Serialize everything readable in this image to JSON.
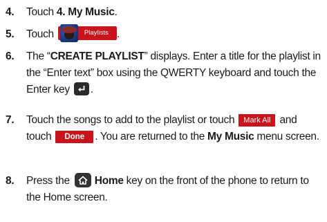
{
  "steps": [
    {
      "number": "4.",
      "pre": "Touch ",
      "bold": "4. My Music",
      "post": "."
    },
    {
      "number": "5.",
      "pre": "Touch ",
      "button_label": "Playlists",
      "post": "."
    },
    {
      "number": "6.",
      "pre": "The “",
      "bold": "CREATE PLAYLIST",
      "mid": "” displays. Enter a title for the playlist in the “Enter text” box using the QWERTY keyboard and touch the Enter key",
      "icon": "enter-key-icon",
      "post": "."
    },
    {
      "number": "7.",
      "pre": "Touch the songs to add to the playlist or touch",
      "mark_all_label": "Mark All",
      "mid": "and touch",
      "done_label": "Done",
      "post_a": ". You are returned to the ",
      "bold": "My Music",
      "post_b": " menu screen."
    },
    {
      "number": "8.",
      "pre": "Press the",
      "icon": "home-key-icon",
      "bold": "Home",
      "post": " key on the front of the phone to return to the Home screen."
    }
  ],
  "colors": {
    "accent_red": "#c8141a",
    "key_dark": "#2a2a2a",
    "text": "#1a1a1a"
  }
}
